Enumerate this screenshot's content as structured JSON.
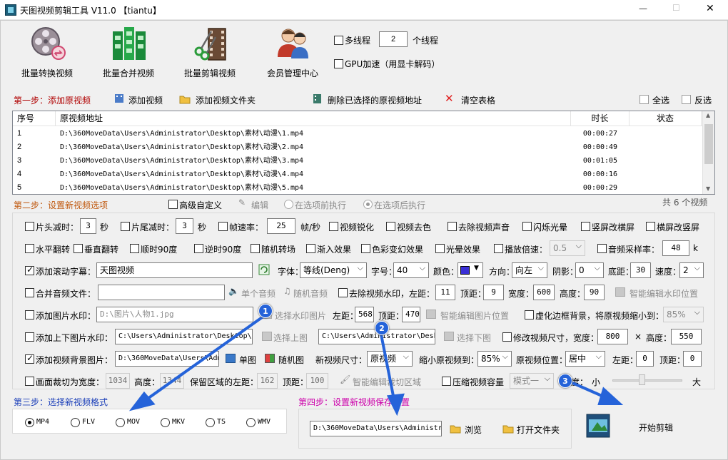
{
  "title": "天图视频剪辑工具 V11.0  【tiantu】",
  "window_controls": {
    "minimize": "—",
    "maximize": "☐",
    "close": "✕"
  },
  "toolbar": {
    "batch_convert": "批量转换视频",
    "batch_merge": "批量合并视频",
    "batch_cut": "批量剪辑视频",
    "member": "会员管理中心",
    "multithread_label": "多线程",
    "thread_count": "2",
    "thread_unit": "个线程",
    "gpu_label": "GPU加速（用显卡解码）"
  },
  "step1": {
    "title": "第一步：添加原视频",
    "add_video": "添加视频",
    "add_folder": "添加视频文件夹",
    "delete_selected": "删除已选择的原视频地址",
    "clear_table": "清空表格",
    "select_all": "全选",
    "invert": "反选"
  },
  "table": {
    "headers": [
      "序号",
      "原视频地址",
      "时长",
      "状态"
    ],
    "rows": [
      {
        "no": "1",
        "path": "D:\\360MoveData\\Users\\Administrator\\Desktop\\素材\\动漫\\1.mp4",
        "duration": "00:00:27",
        "status": ""
      },
      {
        "no": "2",
        "path": "D:\\360MoveData\\Users\\Administrator\\Desktop\\素材\\动漫\\2.mp4",
        "duration": "00:00:49",
        "status": ""
      },
      {
        "no": "3",
        "path": "D:\\360MoveData\\Users\\Administrator\\Desktop\\素材\\动漫\\3.mp4",
        "duration": "00:01:05",
        "status": ""
      },
      {
        "no": "4",
        "path": "D:\\360MoveData\\Users\\Administrator\\Desktop\\素材\\动漫\\4.mp4",
        "duration": "00:00:16",
        "status": ""
      },
      {
        "no": "5",
        "path": "D:\\360MoveData\\Users\\Administrator\\Desktop\\素材\\动漫\\5.mp4",
        "duration": "00:00:29",
        "status": ""
      }
    ],
    "count_text": "共 6 个视频"
  },
  "step2": {
    "title": "第二步：设置新视频选项",
    "advanced": "高级自定义",
    "edit": "编辑",
    "before": "在选项前执行",
    "after": "在选项后执行"
  },
  "row1": {
    "head_cut": "片头减时：",
    "head_val": "3",
    "sec1": "秒",
    "tail_cut": "片尾减时：",
    "tail_val": "3",
    "sec2": "秒",
    "fps": "帧速率：",
    "fps_val": "25",
    "fps_unit": "帧/秒",
    "sharpen": "视频锐化",
    "decolor": "视频去色",
    "mute": "去除视频声音",
    "flash": "闪烁光晕",
    "v2h": "竖屏改横屏",
    "h2v": "横屏改竖屏"
  },
  "row2": {
    "hflip": "水平翻转",
    "vflip": "垂直翻转",
    "rot90": "顺时90度",
    "rot90b": "逆时90度",
    "random_trans": "随机转场",
    "fadein": "渐入效果",
    "color_fx": "色彩变幻效果",
    "light_fx": "光晕效果",
    "speed": "播放倍速：",
    "speed_val": "0.5",
    "sample": "音频采样率：",
    "sample_val": "48",
    "sample_unit": "k"
  },
  "row3": {
    "scroll_sub": "添加滚动字幕：",
    "sub_text": "天图视频",
    "font_label": "字体：",
    "font_val": "等线(Deng)",
    "size_label": "字号：",
    "size_val": "40",
    "color_label": "颜色：",
    "dir_label": "方向：",
    "dir_val": "向左",
    "shadow_label": "阴影：",
    "shadow_val": "0",
    "bottom_label": "底距：",
    "bottom_val": "30",
    "speed_label": "速度：",
    "speed_val": "2",
    "sub_color": "#3a2fd6"
  },
  "row4": {
    "merge_audio": "合并音频文件：",
    "single_audio": "单个音频",
    "random_audio": "随机音频",
    "remove_wm": "去除视频水印，左距：",
    "left_val": "11",
    "top_label": "顶距：",
    "top_val": "9",
    "width_label": "宽度：",
    "width_val": "600",
    "height_label": "高度：",
    "height_val": "90",
    "smart_wm": "智能编辑水印位置"
  },
  "row5": {
    "img_wm": "添加图片水印：",
    "img_path": "D:\\图片\\人物1.jpg",
    "choose_img": "选择水印图片",
    "left_label": "左距：",
    "left_val": "568",
    "top_label": "顶距：",
    "top_val": "470",
    "smart_img": "智能编辑图片位置",
    "blur_border": "虚化边框背景，将原视频缩小到：",
    "blur_val": "85%"
  },
  "row6": {
    "topbottom": "添加上下图片水印：",
    "top_path": "C:\\Users\\Administrator\\Desktop\\素",
    "choose_top": "选择上图",
    "bottom_path": "C:\\Users\\Administrator\\Desk",
    "choose_bottom": "选择下图",
    "resize": "修改视频尺寸，宽度：",
    "w_val": "800",
    "x": "×",
    "h_label": "高度：",
    "h_val": "550"
  },
  "row7": {
    "bg_img": "添加视频背景图片：",
    "bg_path": "D:\\360MoveData\\Users\\Adm",
    "single": "单图",
    "random": "随机图",
    "new_size": "新视频尺寸：",
    "new_size_val": "原视频",
    "shrink": "缩小原视频到：",
    "shrink_val": "85%",
    "pos": "原视频位置：",
    "pos_val": "居中",
    "left_label": "左距：",
    "left_val": "0",
    "top_label": "顶距：",
    "top_val": "0"
  },
  "row8": {
    "crop": "画面裁切为宽度：",
    "crop_w": "1034",
    "h_label": "高度：",
    "crop_h": "1344",
    "keep_left": "保留区域的左距：",
    "keep_left_val": "162",
    "top_label": "顶距：",
    "top_val": "100",
    "smart_crop": "智能编辑裁切区域",
    "compress": "压缩视频容量",
    "mode_val": "模式一",
    "degree": "程度：",
    "small": "小",
    "large": "大",
    "compress_level": 0.42
  },
  "step3": {
    "title": "第三步：选择新视频格式",
    "formats": [
      "MP4",
      "FLV",
      "MOV",
      "MKV",
      "TS",
      "WMV"
    ],
    "selected": "MP4"
  },
  "step4": {
    "title": "第四步：设置新视频保存位置",
    "path": "D:\\360MoveData\\Users\\Administr",
    "browse": "浏览",
    "open_folder": "打开文件夹"
  },
  "start": {
    "label": "开始剪辑"
  },
  "badges": [
    "1",
    "2",
    "3"
  ],
  "colors": {
    "accent_blue": "#2563d9",
    "step_red": "#b00000",
    "step_orange": "#c0590f",
    "step3_blue": "#1a3eb8",
    "step4_magenta": "#cc00aa"
  }
}
